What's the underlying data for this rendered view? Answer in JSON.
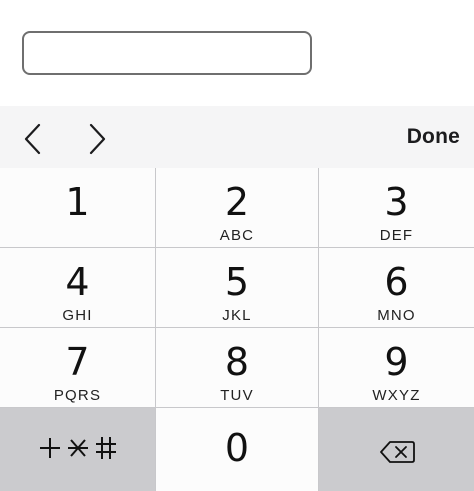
{
  "toolbar": {
    "done_label": "Done"
  },
  "keys": [
    {
      "digit": "1",
      "letters": ""
    },
    {
      "digit": "2",
      "letters": "ABC"
    },
    {
      "digit": "3",
      "letters": "DEF"
    },
    {
      "digit": "4",
      "letters": "GHI"
    },
    {
      "digit": "5",
      "letters": "JKL"
    },
    {
      "digit": "6",
      "letters": "MNO"
    },
    {
      "digit": "7",
      "letters": "PQRS"
    },
    {
      "digit": "8",
      "letters": "TUV"
    },
    {
      "digit": "9",
      "letters": "WXYZ"
    },
    {
      "digit": "0",
      "letters": ""
    }
  ],
  "special_keys": {
    "symbols": "+*#",
    "delete": "delete-icon"
  },
  "colors": {
    "key": "#fcfcfc",
    "dark_key": "#cbcbce",
    "toolbar": "#f5f5f6"
  }
}
